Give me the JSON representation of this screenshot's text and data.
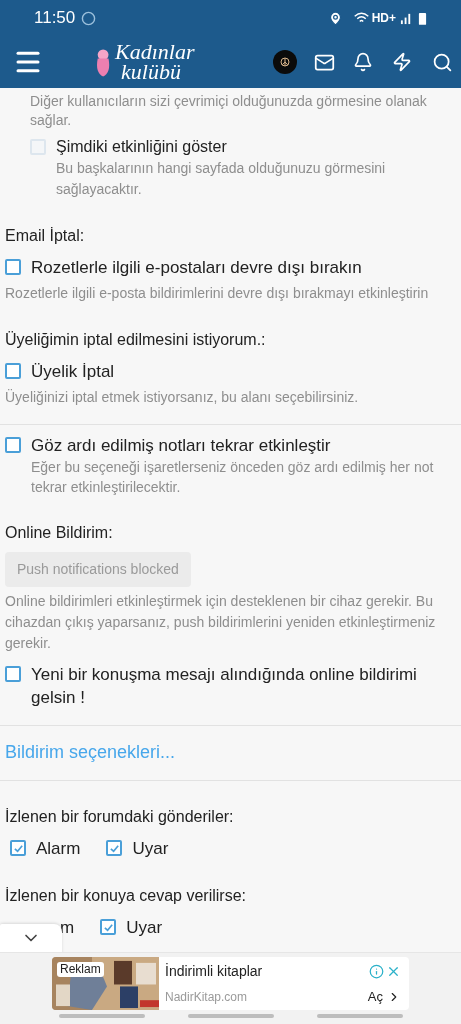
{
  "status_bar": {
    "time": "11:50",
    "network": "HD+"
  },
  "app_bar": {
    "logo_line1": "Kadınlar",
    "logo_line2": "kulübü"
  },
  "blocks": [
    {
      "kind": "sub_note",
      "text": "Diğer kullanıcıların sizi çevrimiçi olduğunuzda görmesine olanak sağlar."
    },
    {
      "kind": "sub_checkbox",
      "label": "Şimdiki etkinliğini göster",
      "checked": false,
      "disabled": true,
      "description": "Bu başkalarının hangi sayfada olduğunuzu görmesini sağlayacaktır."
    },
    {
      "kind": "heading",
      "text": "Email İptal:"
    },
    {
      "kind": "checkbox",
      "label": "Rozetlerle ilgili e-postaları devre dışı bırakın",
      "checked": false,
      "disabled": false
    },
    {
      "kind": "note",
      "text": "Rozetlerle ilgili e-posta bildirimlerini devre dışı bırakmayı etkinleştirin"
    },
    {
      "kind": "heading",
      "text": "Üyeliğimin iptal edilmesini istiyorum.:"
    },
    {
      "kind": "checkbox",
      "label": "Üyelik İptal",
      "checked": false,
      "disabled": false
    },
    {
      "kind": "note",
      "text": "Üyeliğinizi iptal etmek istiyorsanız, bu alanı seçebilirsiniz."
    },
    {
      "kind": "divider"
    },
    {
      "kind": "checkbox",
      "label": "Göz ardı edilmiş notları tekrar etkinleştir",
      "checked": false,
      "disabled": false,
      "description": "Eğer bu seçeneği işaretlerseniz önceden göz ardı edilmiş her not tekrar etkinleştirilecektir."
    },
    {
      "kind": "heading",
      "text": "Online Bildirim:"
    },
    {
      "kind": "button",
      "text": "Push notifications blocked",
      "disabled": true
    },
    {
      "kind": "note",
      "text": "Online bildirimleri etkinleştirmek için desteklenen bir cihaz gerekir. Bu cihazdan çıkış yaparsanız, push bildirimlerini yeniden etkinleştirmeniz gerekir."
    },
    {
      "kind": "checkbox",
      "label": "Yeni bir konuşma mesajı alındığında online bildirimi gelsin !",
      "checked": false,
      "disabled": false
    },
    {
      "kind": "divider"
    },
    {
      "kind": "link",
      "text": "Bildirim seçenekleri..."
    },
    {
      "kind": "divider"
    },
    {
      "kind": "heading",
      "text": "İzlenen bir forumdaki gönderiler:"
    },
    {
      "kind": "checkbox_row",
      "items": [
        {
          "kind": "checkbox",
          "label": "Alarm",
          "checked": true
        },
        {
          "kind": "checkbox",
          "label": "Uyar",
          "checked": true
        }
      ]
    },
    {
      "kind": "heading",
      "text": "İzlenen bir konuya cevap verilirse:"
    },
    {
      "kind": "checkbox_row",
      "items": [
        {
          "kind": "cut_text",
          "label": "m"
        },
        {
          "kind": "checkbox",
          "label": "Uyar",
          "checked": true
        }
      ]
    }
  ],
  "ad": {
    "badge": "Reklam",
    "title": "İndirimli kitaplar",
    "domain": "NadirKitap.com",
    "action": "Aç"
  }
}
